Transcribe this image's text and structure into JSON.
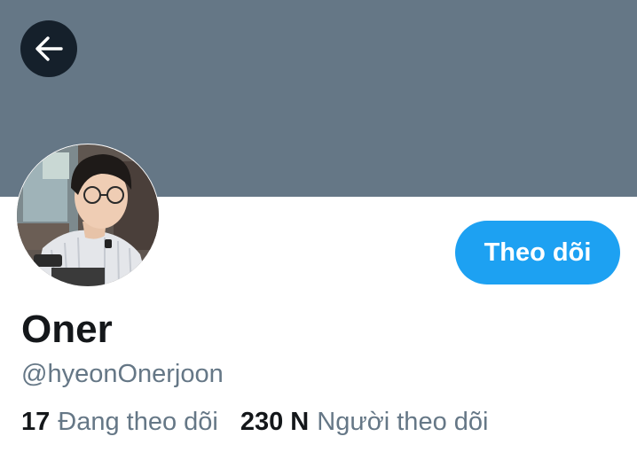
{
  "header": {
    "back_icon": "arrow-left-icon",
    "banner_color": "#657786"
  },
  "profile": {
    "avatar_alt": "profile photo",
    "display_name": "Oner",
    "handle": "@hyeonOnerjoon",
    "follow_label": "Theo dõi",
    "accent_color": "#1da1f2"
  },
  "stats": {
    "following_count": "17",
    "following_label": "Đang theo dõi",
    "followers_count": "230 N",
    "followers_label": "Người theo dõi"
  }
}
